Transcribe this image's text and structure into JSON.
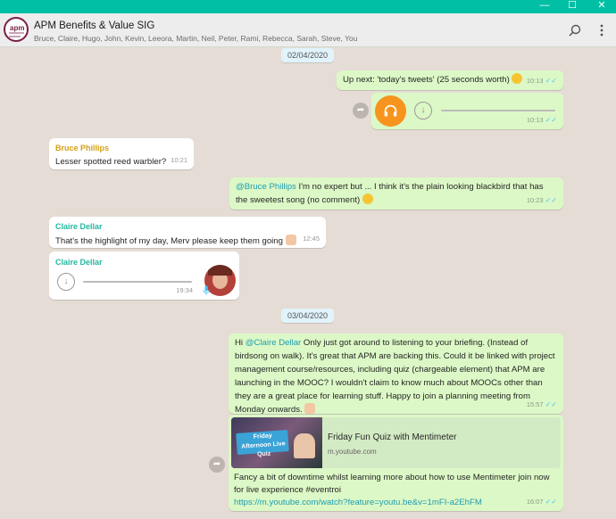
{
  "window": {
    "minimize": "—",
    "maximize": "☐",
    "close": "✕"
  },
  "header": {
    "avatar_text": "apm",
    "title": "APM Benefits & Value SIG",
    "members": "Bruce, Claire, Hugo, John, Kevin, Leeora, Martin, Neil, Peter, Rami, Rebecca, Sarah, Steve, You",
    "search_icon": "search-icon",
    "menu_icon": "more-vert-icon"
  },
  "colors": {
    "titlebar": "#00bfa5",
    "bubble_out": "#dcf8c6",
    "bubble_in": "#ffffff",
    "bruce_name": "#d4a017",
    "claire_name": "#22b8a0",
    "audio_play": "#f7941d",
    "mention": "#1e9db2"
  },
  "messages": {
    "date1": "02/04/2020",
    "m1": {
      "text": "Up next: 'today's tweets' (25 seconds worth)",
      "time": "10:13"
    },
    "m2": {
      "time": "10:13"
    },
    "m3": {
      "sender": "Bruce Phillips",
      "text": "Lesser spotted reed warbler?",
      "time": "10:21"
    },
    "m4": {
      "mention": "@Bruce Phillips",
      "text": " I'm no expert but ... I think it's the plain looking blackbird that has the sweetest song (no comment)",
      "time": "10:23"
    },
    "m5": {
      "sender": "Claire Dellar",
      "text": "That's the highlight of my day, Merv please keep them going",
      "time": "12:45"
    },
    "m6": {
      "sender": "Claire Dellar",
      "time": "19:34"
    },
    "date2": "03/04/2020",
    "m7": {
      "prefix": "Hi ",
      "mention": "@Claire Dellar",
      "text": " Only just got around to listening to your briefing. (Instead of birdsong on walk). It's great that APM are backing this. Could it be linked with project management course/resources, including quiz (chargeable element) that APM are launching in the MOOC? I wouldn't claim to know much about MOOCs other than they are a great place for learning stuff. Happy to join a planning meeting from Monday onwards.",
      "time": "15:57"
    },
    "m8": {
      "thumb_text": "Friday Afternoon Live Quiz",
      "link_title": "Friday Fun Quiz with Mentimeter",
      "link_domain": "m.youtube.com",
      "text": "Fancy a bit of downtime whilst learning more about how to use Mentimeter join now for live experience #eventroi",
      "url": "https://m.youtube.com/watch?feature=youtu.be&v=1mFI-a2EhFM",
      "time": "16:07"
    }
  }
}
